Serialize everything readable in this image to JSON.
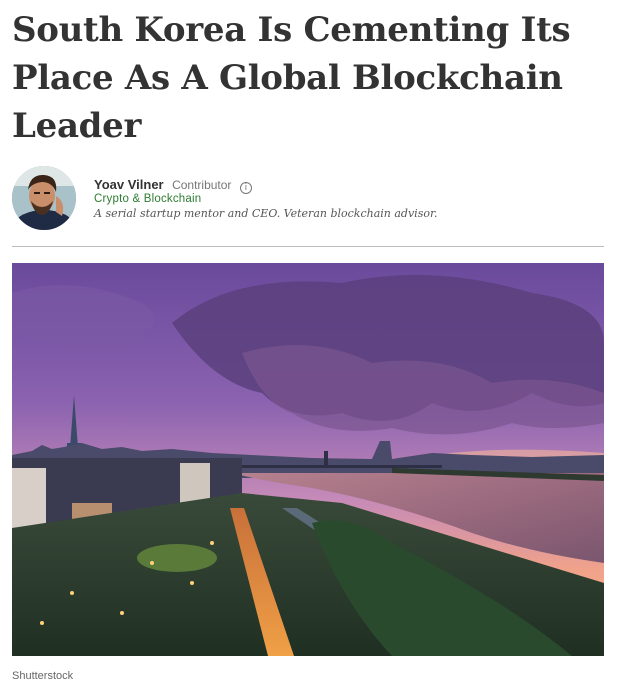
{
  "article": {
    "headline": "South Korea Is Cementing Its Place As A Global Blockchain Leader"
  },
  "author": {
    "name": "Yoav Vilner",
    "role": "Contributor",
    "info_icon": "info-icon",
    "section": "Crypto & Blockchain",
    "bio": "A serial startup mentor and CEO. Veteran blockchain advisor."
  },
  "hero_image": {
    "alt": "Seoul skyline at sunset over the Han River",
    "credit": "Shutterstock"
  },
  "colors": {
    "headline": "#333333",
    "section_link": "#2e7d32",
    "divider": "#bbbbbb"
  }
}
